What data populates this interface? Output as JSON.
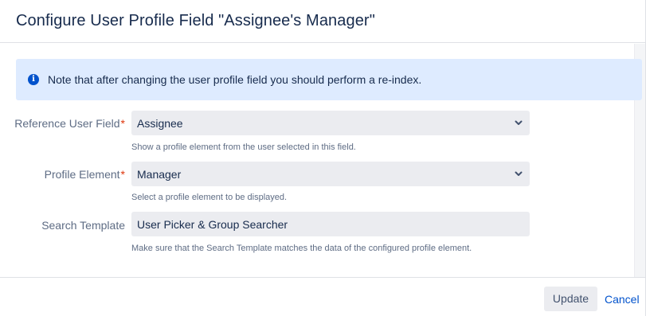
{
  "dialog": {
    "title": "Configure User Profile Field \"Assignee's Manager\""
  },
  "info_banner": {
    "icon": "info-icon",
    "text": "Note that after changing the user profile field you should perform a re-index."
  },
  "fields": [
    {
      "label": "Reference User Field",
      "required": true,
      "value": "Assignee",
      "help": "Show a profile element from the user selected in this field."
    },
    {
      "label": "Profile Element",
      "required": true,
      "value": "Manager",
      "help": "Select a profile element to be displayed."
    },
    {
      "label": "Search Template",
      "required": false,
      "value": "User Picker & Group Searcher",
      "help": "Make sure that the Search Template matches the data of the configured profile element."
    }
  ],
  "required_marker": "*",
  "footer": {
    "update_label": "Update",
    "cancel_label": "Cancel"
  },
  "colors": {
    "accent": "#0052cc",
    "required": "#de350b",
    "banner_bg": "#deebff",
    "select_bg": "#ebecf0"
  }
}
